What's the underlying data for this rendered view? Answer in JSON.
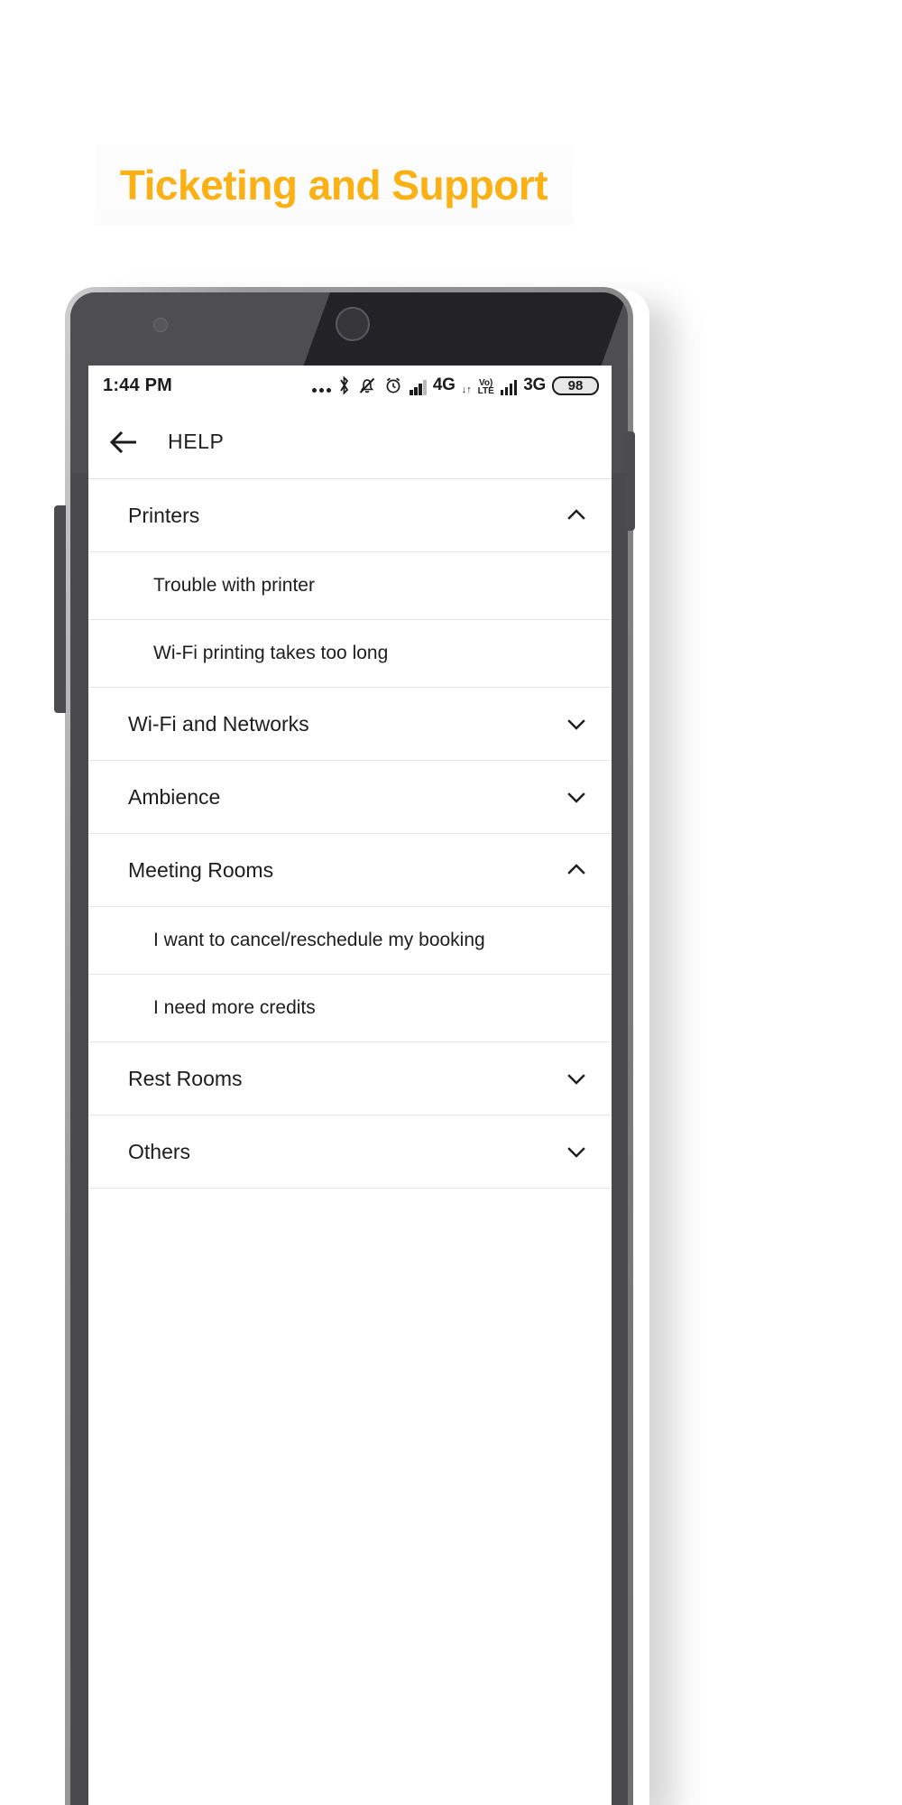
{
  "banner": {
    "title": "Ticketing and Support",
    "accent_color": "#fbb014"
  },
  "status_bar": {
    "time": "1:44 PM",
    "icons": [
      "more-dots-icon",
      "bluetooth-icon",
      "notifications-muted-icon",
      "alarm-icon"
    ],
    "network_1": "4G",
    "data_indicator": "↓↑",
    "volte_top": "Vo)",
    "volte_bottom": "LTE",
    "network_2": "3G",
    "battery_level": "98"
  },
  "app_bar": {
    "back_label": "back-arrow",
    "title": "HELP"
  },
  "list": {
    "rows": [
      {
        "label": "Printers",
        "type": "group",
        "expanded": true,
        "chevron": "chevron-up-icon"
      },
      {
        "label": "Trouble with printer",
        "type": "child"
      },
      {
        "label": "Wi-Fi printing takes too long",
        "type": "child"
      },
      {
        "label": "Wi-Fi and Networks",
        "type": "group",
        "expanded": false,
        "chevron": "chevron-down-icon"
      },
      {
        "label": "Ambience",
        "type": "group",
        "expanded": false,
        "chevron": "chevron-down-icon"
      },
      {
        "label": "Meeting Rooms",
        "type": "group",
        "expanded": true,
        "chevron": "chevron-up-icon"
      },
      {
        "label": "I want to cancel/reschedule my booking",
        "type": "child"
      },
      {
        "label": "I need more credits",
        "type": "child"
      },
      {
        "label": "Rest Rooms",
        "type": "group",
        "expanded": false,
        "chevron": "chevron-down-icon"
      },
      {
        "label": "Others",
        "type": "group",
        "expanded": false,
        "chevron": "chevron-down-icon"
      }
    ]
  }
}
